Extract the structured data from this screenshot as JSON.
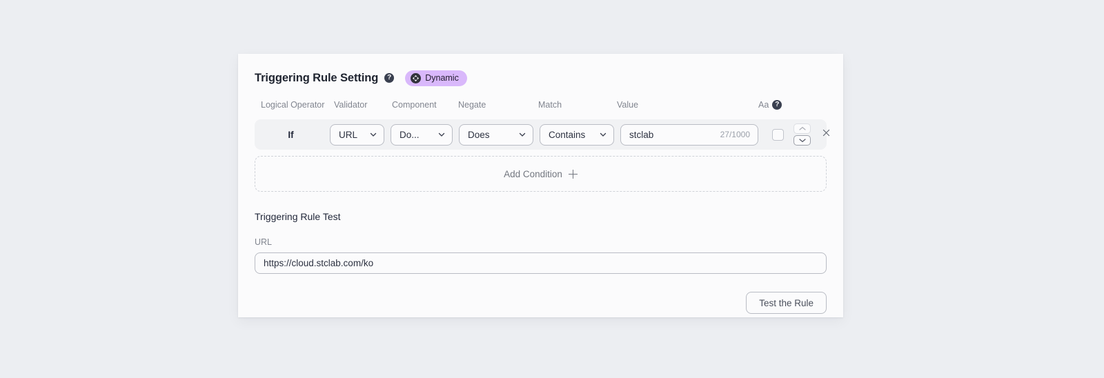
{
  "header": {
    "title": "Triggering Rule Setting",
    "help_icon": "question-mark-circle-icon",
    "badge": {
      "label": "Dynamic",
      "icon": "dynamic-arrows-icon",
      "bg_color": "#d9b8fb",
      "text_color": "#201b2c"
    }
  },
  "columns": {
    "logical_operator": "Logical Operator",
    "validator": "Validator",
    "component": "Component",
    "negate": "Negate",
    "match": "Match",
    "value": "Value",
    "case_sensitivity": "Aa",
    "case_help_icon": "question-mark-circle-icon"
  },
  "condition": {
    "logical_operator": "If",
    "validator": "URL",
    "component": "Do...",
    "negate": "Does",
    "match": "Contains",
    "value": "stclab",
    "value_counter": "27/1000",
    "case_sensitive_checked": false,
    "move_up_icon": "chevron-up-icon",
    "move_down_icon": "chevron-down-icon",
    "remove_icon": "close-x-icon"
  },
  "add_condition": {
    "label": "Add Condition",
    "icon": "plus-icon"
  },
  "test_section": {
    "title": "Triggering Rule Test",
    "url_label": "URL",
    "url_value": "https://cloud.stclab.com/ko",
    "url_placeholder": "https://cloud.stclab.com/ko",
    "test_button": "Test the Rule"
  }
}
